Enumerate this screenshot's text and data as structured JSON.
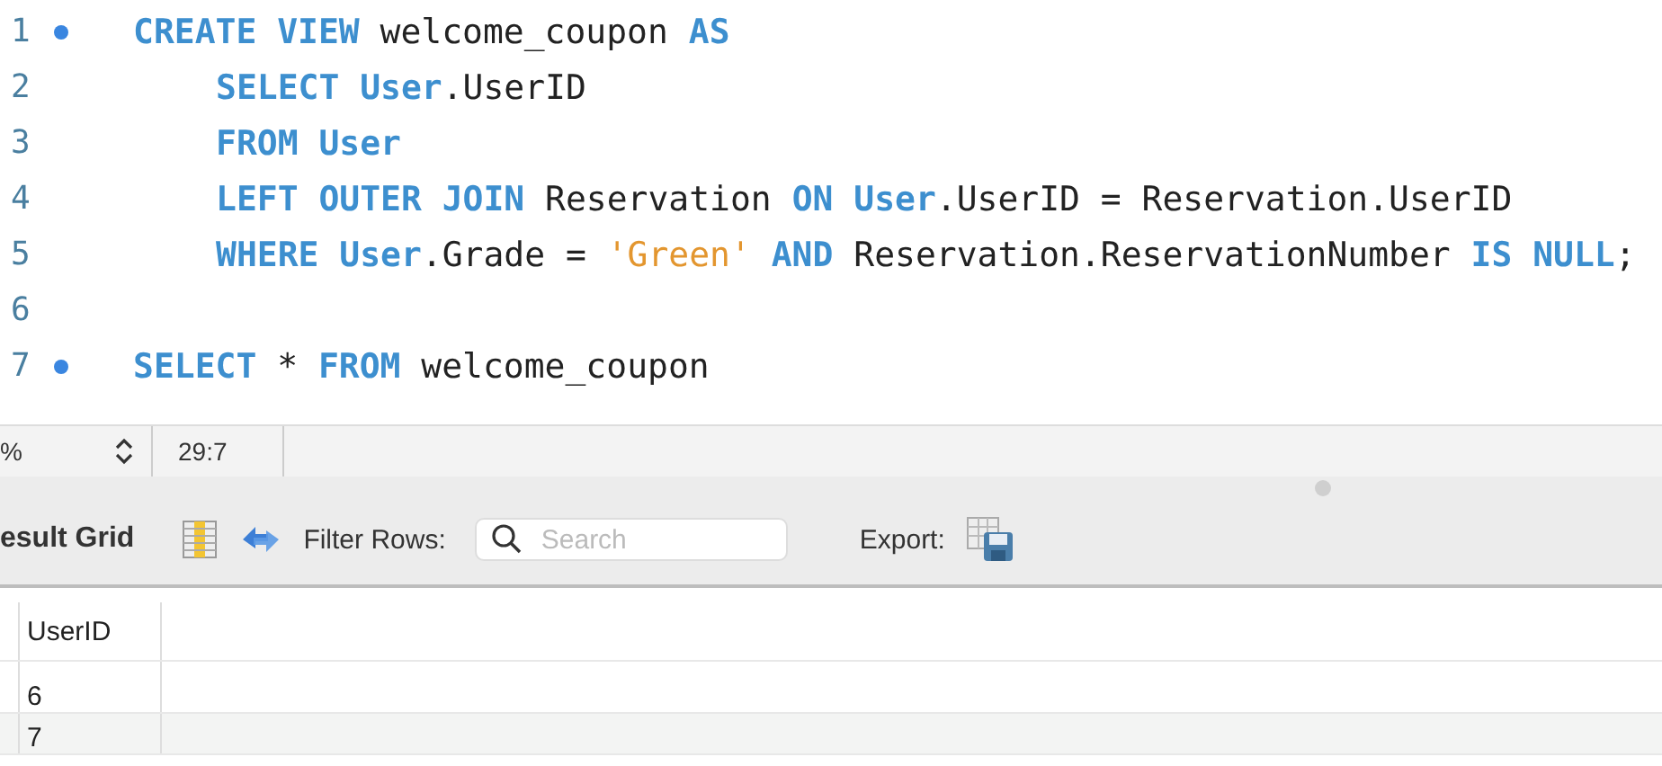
{
  "editor": {
    "lines": [
      {
        "number": "1",
        "breakpoint": true,
        "indent": false,
        "tokens": [
          {
            "text": "CREATE VIEW",
            "kind": "keyword"
          },
          {
            "text": " welcome_coupon ",
            "kind": "plain"
          },
          {
            "text": "AS",
            "kind": "keyword"
          }
        ]
      },
      {
        "number": "2",
        "breakpoint": false,
        "indent": true,
        "tokens": [
          {
            "text": "SELECT User",
            "kind": "keyword"
          },
          {
            "text": ".UserID",
            "kind": "plain"
          }
        ]
      },
      {
        "number": "3",
        "breakpoint": false,
        "indent": true,
        "tokens": [
          {
            "text": "FROM User",
            "kind": "keyword"
          }
        ]
      },
      {
        "number": "4",
        "breakpoint": false,
        "indent": true,
        "tokens": [
          {
            "text": "LEFT OUTER JOIN",
            "kind": "keyword"
          },
          {
            "text": " Reservation ",
            "kind": "plain"
          },
          {
            "text": "ON User",
            "kind": "keyword"
          },
          {
            "text": ".UserID = Reservation.UserID",
            "kind": "plain"
          }
        ]
      },
      {
        "number": "5",
        "breakpoint": false,
        "indent": true,
        "tokens": [
          {
            "text": "WHERE User",
            "kind": "keyword"
          },
          {
            "text": ".Grade = ",
            "kind": "plain"
          },
          {
            "text": "'Green'",
            "kind": "string"
          },
          {
            "text": " AND",
            "kind": "keyword"
          },
          {
            "text": " Reservation.ReservationNumber ",
            "kind": "plain"
          },
          {
            "text": "IS NULL",
            "kind": "keyword"
          },
          {
            "text": ";",
            "kind": "plain"
          }
        ]
      },
      {
        "number": "6",
        "breakpoint": false
      },
      {
        "number": "7",
        "breakpoint": true,
        "indent": false,
        "tokens": [
          {
            "text": "SELECT",
            "kind": "keyword"
          },
          {
            "text": " * ",
            "kind": "plain"
          },
          {
            "text": "FROM",
            "kind": "keyword"
          },
          {
            "text": " welcome_coupon",
            "kind": "plain"
          }
        ]
      }
    ]
  },
  "status_bar": {
    "zoom": "%",
    "position": "29:7"
  },
  "toolbar": {
    "title": "esult Grid",
    "filter_label": "Filter Rows:",
    "search": {
      "placeholder": "Search"
    },
    "export_label": "Export:"
  },
  "grid": {
    "columns": [
      "UserID"
    ],
    "rows": [
      [
        "6"
      ],
      [
        "7"
      ]
    ]
  }
}
